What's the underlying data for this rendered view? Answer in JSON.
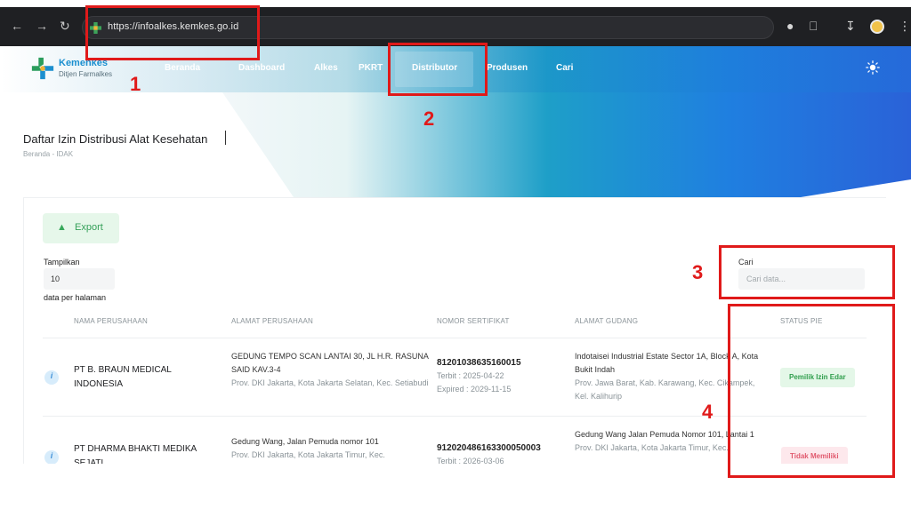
{
  "browser": {
    "url": "https://infoalkes.kemkes.go.id"
  },
  "header": {
    "logo_title": "Kemenkes",
    "logo_subtitle": "Ditjen Farmalkes",
    "menu": [
      "Beranda",
      "Dashboard",
      "Alkes",
      "PKRT",
      "Distributor",
      "Produsen",
      "Cari"
    ],
    "active_menu": "Distributor"
  },
  "page": {
    "title": "Daftar Izin Distribusi Alat Kesehatan",
    "breadcrumb": "Beranda - IDAK"
  },
  "toolbar": {
    "export_label": "Export",
    "show_label": "Tampilkan",
    "page_size": "10",
    "per_page_label": "data per halaman",
    "search_label": "Cari",
    "search_placeholder": "Cari data..."
  },
  "table": {
    "headers": [
      "NAMA PERUSAHAAN",
      "ALAMAT PERUSAHAAN",
      "NOMOR SERTIFIKAT",
      "ALAMAT GUDANG",
      "STATUS PIE"
    ],
    "rows": [
      {
        "company": "PT B. BRAUN MEDICAL INDONESIA",
        "address": "GEDUNG TEMPO SCAN LANTAI 30, JL H.R. RASUNA SAID KAV.3-4",
        "address_region": "Prov. DKI Jakarta, Kota Jakarta Selatan, Kec. Setiabudi",
        "cert_no": "81201038635160015",
        "issued": "Terbit : 2025-04-22",
        "expired": "Expired : 2029-11-15",
        "warehouse": "Indotaisei Industrial Estate Sector 1A, Block A, Kota Bukit Indah",
        "warehouse_region": "Prov. Jawa Barat, Kab. Karawang, Kec. Cikampek, Kel. Kalihurip",
        "status": "Pemilik Izin Edar"
      },
      {
        "company": "PT DHARMA BHAKTI MEDIKA SEJATI",
        "address": "Gedung Wang, Jalan Pemuda nomor 101",
        "address_region": "Prov. DKI Jakarta, Kota Jakarta Timur, Kec.",
        "cert_no": "912020486163300050003",
        "issued": "Terbit : 2026-03-06",
        "expired": "",
        "warehouse": "Gedung Wang Jalan Pemuda Nomor 101, Lantai 1",
        "warehouse_region": "Prov. DKI Jakarta, Kota Jakarta Timur, Kec.",
        "status": "Tidak Memiliki"
      }
    ]
  },
  "annotations": {
    "n1": "1",
    "n2": "2",
    "n3": "3",
    "n4": "4",
    "color": "#e01a1a"
  },
  "colors": {
    "accent_blue": "#1f7fe0",
    "teal": "#1e9fc8",
    "success_bg": "#e4f7e8",
    "success_text": "#2f9e4c",
    "danger_bg": "#fde8ec",
    "danger_text": "#e15a6e"
  },
  "icons": {
    "back": "arrow-left-icon",
    "forward": "arrow-right-icon",
    "reload": "reload-icon",
    "theme": "sun-icon",
    "info": "info-icon",
    "export": "upload-icon"
  }
}
